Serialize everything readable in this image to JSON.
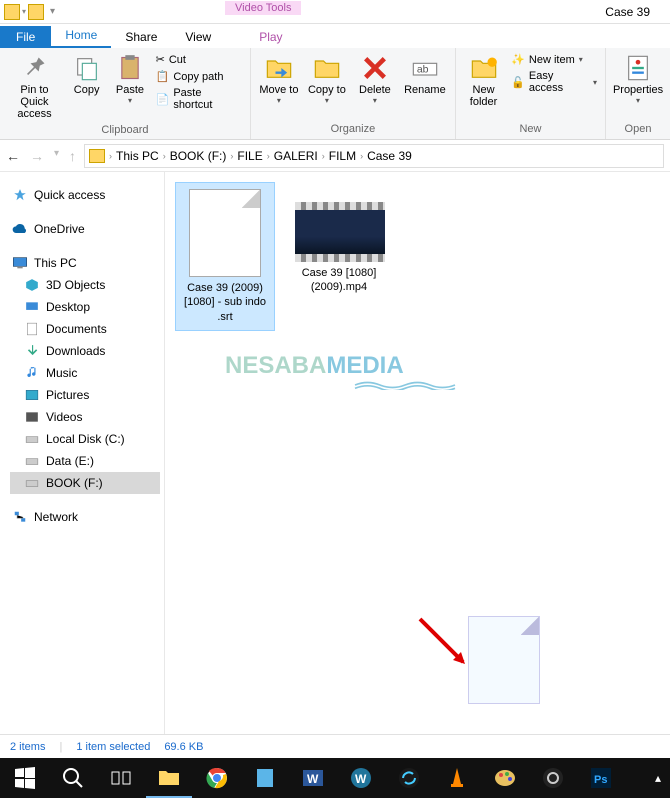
{
  "window": {
    "title": "Case 39",
    "video_tools_label": "Video Tools",
    "play_tab": "Play"
  },
  "tabs": {
    "file": "File",
    "home": "Home",
    "share": "Share",
    "view": "View"
  },
  "ribbon": {
    "clipboard": {
      "label": "Clipboard",
      "pin": "Pin to Quick access",
      "copy": "Copy",
      "paste": "Paste",
      "cut": "Cut",
      "copy_path": "Copy path",
      "paste_shortcut": "Paste shortcut"
    },
    "organize": {
      "label": "Organize",
      "move_to": "Move to",
      "copy_to": "Copy to",
      "delete": "Delete",
      "rename": "Rename"
    },
    "new": {
      "label": "New",
      "new_folder": "New folder",
      "new_item": "New item",
      "easy_access": "Easy access"
    },
    "open": {
      "label": "Open",
      "properties": "Properties"
    }
  },
  "breadcrumb": [
    "This PC",
    "BOOK (F:)",
    "FILE",
    "GALERI",
    "FILM",
    "Case 39"
  ],
  "nav_pane": {
    "quick_access": "Quick access",
    "onedrive": "OneDrive",
    "this_pc": "This PC",
    "objects_3d": "3D Objects",
    "desktop": "Desktop",
    "documents": "Documents",
    "downloads": "Downloads",
    "music": "Music",
    "pictures": "Pictures",
    "videos": "Videos",
    "local_disk": "Local Disk (C:)",
    "data_e": "Data (E:)",
    "book_f": "BOOK (F:)",
    "network": "Network"
  },
  "files": [
    {
      "name": "Case 39 (2009) [1080] - sub indo .srt",
      "selected": true,
      "type": "file"
    },
    {
      "name": "Case 39 [1080] (2009).mp4",
      "selected": false,
      "type": "video"
    }
  ],
  "watermark": {
    "part1": "NESABA",
    "part2": "MEDIA"
  },
  "status": {
    "count": "2 items",
    "selected": "1 item selected",
    "size": "69.6 KB"
  },
  "taskbar_items": [
    "start",
    "search",
    "task-view",
    "file-explorer",
    "chrome",
    "notes",
    "word",
    "wordpress",
    "sync",
    "vlc",
    "paint",
    "obs",
    "photoshop"
  ]
}
